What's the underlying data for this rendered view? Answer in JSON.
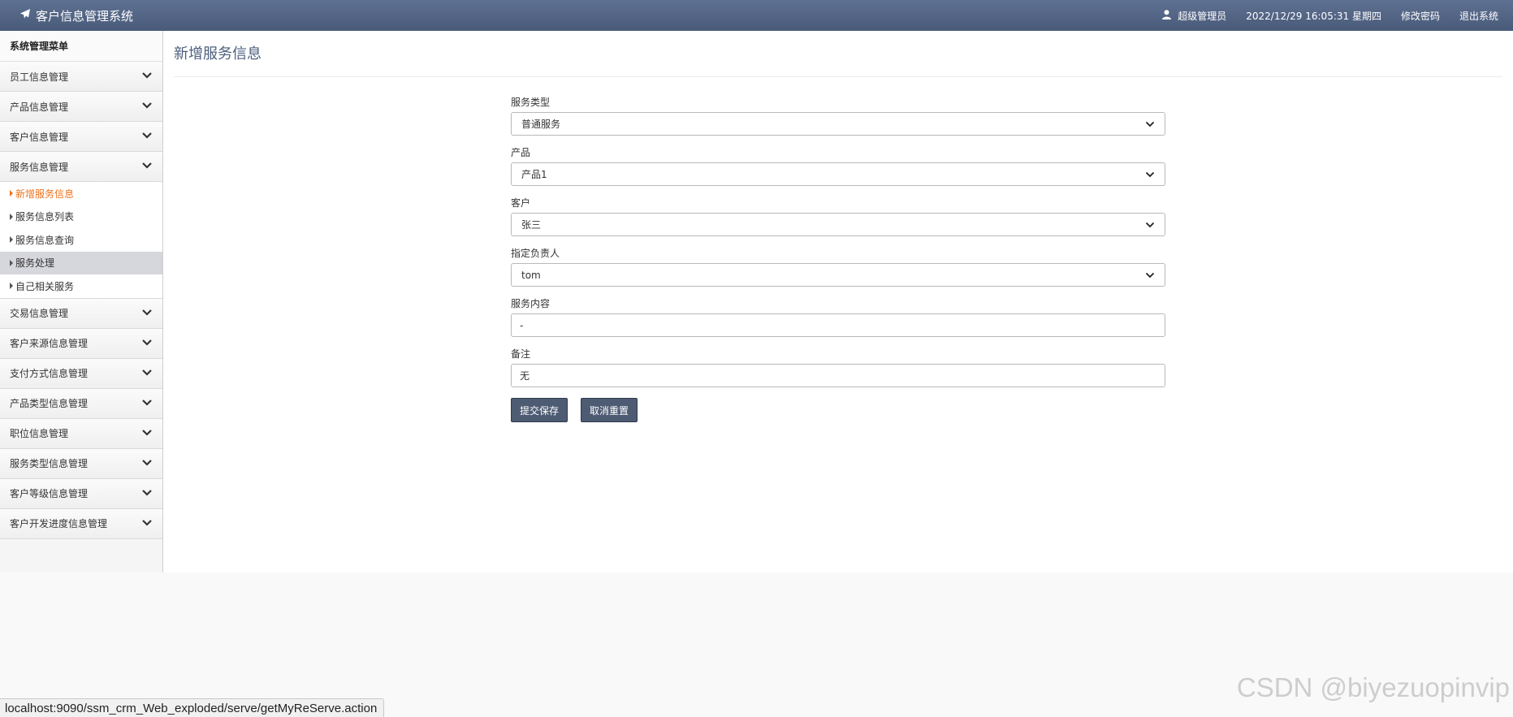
{
  "header": {
    "app_title": "客户信息管理系统",
    "user": "超级管理员",
    "datetime": "2022/12/29 16:05:31 星期四",
    "change_password": "修改密码",
    "logout": "退出系统"
  },
  "sidebar": {
    "title": "系统管理菜单",
    "groups_top": [
      {
        "label": "员工信息管理"
      },
      {
        "label": "产品信息管理"
      },
      {
        "label": "客户信息管理"
      },
      {
        "label": "服务信息管理"
      }
    ],
    "submenu": [
      {
        "label": "新增服务信息",
        "state": "active"
      },
      {
        "label": "服务信息列表"
      },
      {
        "label": "服务信息查询"
      },
      {
        "label": "服务处理",
        "state": "hover"
      },
      {
        "label": "自己相关服务"
      }
    ],
    "groups_bottom": [
      {
        "label": "交易信息管理"
      },
      {
        "label": "客户来源信息管理"
      },
      {
        "label": "支付方式信息管理"
      },
      {
        "label": "产品类型信息管理"
      },
      {
        "label": "职位信息管理"
      },
      {
        "label": "服务类型信息管理"
      },
      {
        "label": "客户等级信息管理"
      },
      {
        "label": "客户开发进度信息管理"
      }
    ]
  },
  "main": {
    "page_title": "新增服务信息",
    "form": {
      "service_type": {
        "label": "服务类型",
        "value": "普通服务"
      },
      "product": {
        "label": "产品",
        "value": "产品1"
      },
      "customer": {
        "label": "客户",
        "value": "张三"
      },
      "owner": {
        "label": "指定负责人",
        "value": "tom"
      },
      "content": {
        "label": "服务内容",
        "value": "-"
      },
      "remark": {
        "label": "备注",
        "value": "无"
      }
    },
    "submit_label": "提交保存",
    "reset_label": "取消重置"
  },
  "statusbar": {
    "url": "localhost:9090/ssm_crm_Web_exploded/serve/getMyReServe.action"
  },
  "watermark": "CSDN @biyezuopinvip"
}
